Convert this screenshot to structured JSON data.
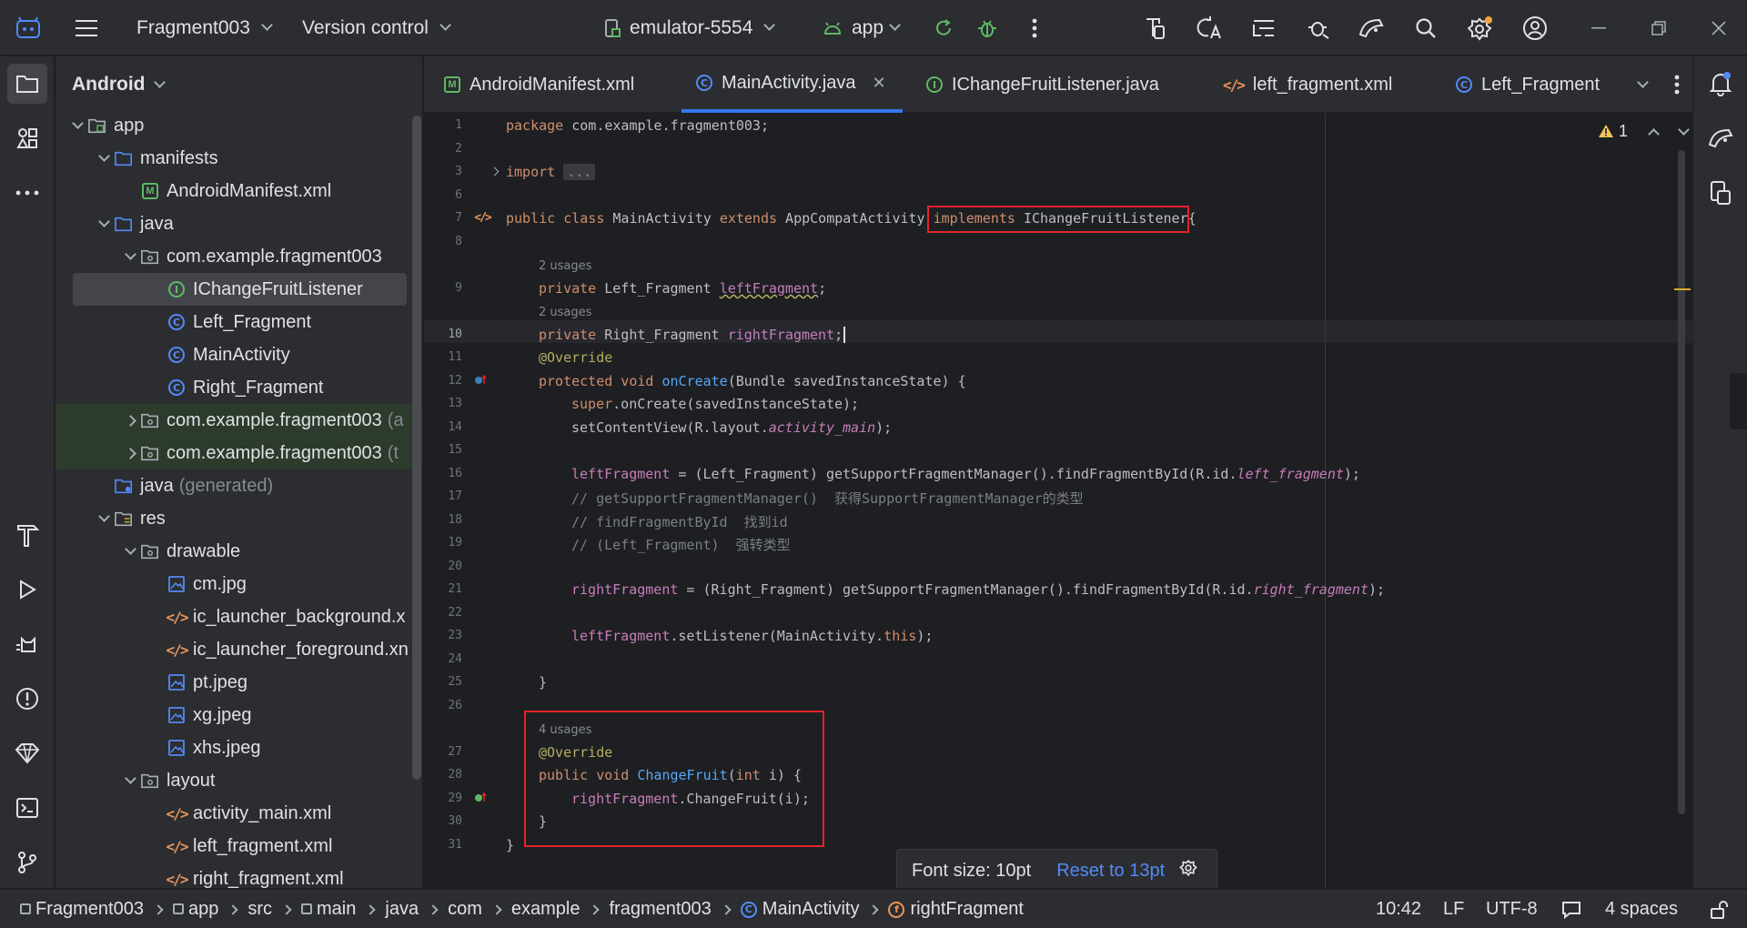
{
  "titlebar": {
    "project": "Fragment003",
    "vcs": "Version control",
    "device": "emulator-5554",
    "run_config": "app"
  },
  "project_panel": {
    "title": "Android",
    "tree": [
      {
        "label": "app",
        "extra": "",
        "depth": 0,
        "expand": "down",
        "icon": "module"
      },
      {
        "label": "manifests",
        "extra": "",
        "depth": 1,
        "expand": "down",
        "icon": "folder"
      },
      {
        "label": "AndroidManifest.xml",
        "extra": "",
        "depth": 2,
        "expand": "",
        "icon": "manifest"
      },
      {
        "label": "java",
        "extra": "",
        "depth": 1,
        "expand": "down",
        "icon": "folder"
      },
      {
        "label": "com.example.fragment003",
        "extra": "",
        "depth": 2,
        "expand": "down",
        "icon": "package"
      },
      {
        "label": "IChangeFruitListener",
        "extra": "",
        "depth": 3,
        "expand": "",
        "icon": "interface",
        "selected": true
      },
      {
        "label": "Left_Fragment",
        "extra": "",
        "depth": 3,
        "expand": "",
        "icon": "class"
      },
      {
        "label": "MainActivity",
        "extra": "",
        "depth": 3,
        "expand": "",
        "icon": "class"
      },
      {
        "label": "Right_Fragment",
        "extra": "",
        "depth": 3,
        "expand": "",
        "icon": "class"
      },
      {
        "label": "com.example.fragment003",
        "extra": "(a",
        "depth": 2,
        "expand": "right",
        "icon": "package",
        "green": true
      },
      {
        "label": "com.example.fragment003",
        "extra": "(t",
        "depth": 2,
        "expand": "right",
        "icon": "package",
        "green": true
      },
      {
        "label": "java",
        "extra": "(generated)",
        "depth": 1,
        "expand": "",
        "icon": "genfolder"
      },
      {
        "label": "res",
        "extra": "",
        "depth": 1,
        "expand": "down",
        "icon": "resfolder"
      },
      {
        "label": "drawable",
        "extra": "",
        "depth": 2,
        "expand": "down",
        "icon": "package"
      },
      {
        "label": "cm.jpg",
        "extra": "",
        "depth": 3,
        "expand": "",
        "icon": "image"
      },
      {
        "label": "ic_launcher_background.x",
        "extra": "",
        "depth": 3,
        "expand": "",
        "icon": "xml"
      },
      {
        "label": "ic_launcher_foreground.xn",
        "extra": "",
        "depth": 3,
        "expand": "",
        "icon": "xml"
      },
      {
        "label": "pt.jpeg",
        "extra": "",
        "depth": 3,
        "expand": "",
        "icon": "image"
      },
      {
        "label": "xg.jpeg",
        "extra": "",
        "depth": 3,
        "expand": "",
        "icon": "image"
      },
      {
        "label": "xhs.jpeg",
        "extra": "",
        "depth": 3,
        "expand": "",
        "icon": "image"
      },
      {
        "label": "layout",
        "extra": "",
        "depth": 2,
        "expand": "down",
        "icon": "package"
      },
      {
        "label": "activity_main.xml",
        "extra": "",
        "depth": 3,
        "expand": "",
        "icon": "xml"
      },
      {
        "label": "left_fragment.xml",
        "extra": "",
        "depth": 3,
        "expand": "",
        "icon": "xml"
      },
      {
        "label": "right_fragment.xml",
        "extra": "",
        "depth": 3,
        "expand": "",
        "icon": "xml"
      }
    ]
  },
  "tabs": [
    {
      "label": "AndroidManifest.xml",
      "icon": "manifest"
    },
    {
      "label": "MainActivity.java",
      "icon": "class",
      "active": true
    },
    {
      "label": "IChangeFruitListener.java",
      "icon": "interface"
    },
    {
      "label": "left_fragment.xml",
      "icon": "xml"
    },
    {
      "label": "Left_Fragment",
      "icon": "class"
    }
  ],
  "editor": {
    "warning_count": "1",
    "usages": [
      "2 usages",
      "2 usages",
      "4 usages"
    ],
    "line_numbers": [
      "1",
      "2",
      "3",
      "6",
      "7",
      "8",
      "9",
      "10",
      "11",
      "12",
      "13",
      "14",
      "15",
      "16",
      "17",
      "18",
      "19",
      "20",
      "21",
      "22",
      "23",
      "24",
      "25",
      "26",
      "27",
      "28",
      "29",
      "30",
      "31"
    ],
    "code": {
      "l1a": "package",
      "l1b": " com.example.fragment003;",
      "l3a": "import",
      "l3b": "...",
      "l7a": "public class",
      "l7b": " MainActivity ",
      "l7c": "extends",
      "l7d": " AppCompatActivity ",
      "l7e": "implements",
      "l7f": " IChangeFruitListener{",
      "l9a": "private",
      "l9b": " Left_Fragment ",
      "l9c": "leftFragment",
      "l9d": ";",
      "l10a": "private",
      "l10b": " Right_Fragment ",
      "l10c": "rightFragment",
      "l10d": ";",
      "l11": "@Override",
      "l12a": "protected void",
      "l12b": "onCreate",
      "l12c": "(Bundle savedInstanceState) {",
      "l13a": "super",
      "l13b": ".onCreate(savedInstanceState);",
      "l14a": "setContentView(R.layout.",
      "l14b": "activity_main",
      "l14c": ");",
      "l16a": "leftFragment",
      "l16b": " = (Left_Fragment) getSupportFragmentManager().findFragmentById(R.id.",
      "l16c": "left_fragment",
      "l16d": ");",
      "l17": "// getSupportFragmentManager()  获得SupportFragmentManager的类型",
      "l18": "// findFragmentById  找到id",
      "l19": "// (Left_Fragment)  强转类型",
      "l21a": "rightFragment",
      "l21b": " = (Right_Fragment) getSupportFragmentManager().findFragmentById(R.id.",
      "l21c": "right_fragment",
      "l21d": ");",
      "l23a": "leftFragment",
      "l23b": ".setListener(MainActivity.",
      "l23c": "this",
      "l23d": ");",
      "l25": "}",
      "l27": "@Override",
      "l28a": "public void",
      "l28b": "ChangeFruit",
      "l28c": "(",
      "l28d": "int",
      "l28e": " i) {",
      "l29a": "rightFragment",
      "l29b": ".ChangeFruit(i);",
      "l30": "}",
      "l31": "}"
    }
  },
  "font_popup": {
    "text": "Font size: 10pt",
    "reset": "Reset to 13pt"
  },
  "statusbar": {
    "breadcrumbs": [
      "Fragment003",
      "app",
      "src",
      "main",
      "java",
      "com",
      "example",
      "fragment003",
      "MainActivity",
      "rightFragment"
    ],
    "position": "10:42",
    "line_sep": "LF",
    "encoding": "UTF-8",
    "indent": "4 spaces"
  },
  "colors": {
    "accent": "#3574f0",
    "annotation_box": "#e5212a",
    "keyword": "#cf8e6d",
    "field": "#c77dbb",
    "method": "#56a8f5"
  }
}
